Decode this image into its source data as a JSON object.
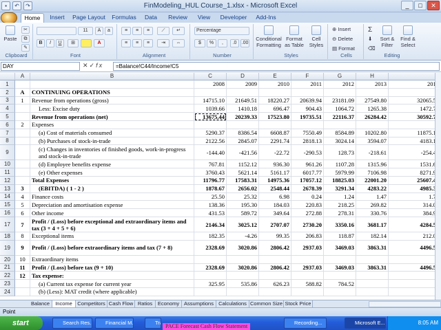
{
  "window": {
    "title": "FinModeling_HUL Course_1.xlsx - Microsoft Excel"
  },
  "ribbon_tabs": [
    "Home",
    "Insert",
    "Page Layout",
    "Formulas",
    "Data",
    "Review",
    "View",
    "Developer",
    "Add-Ins"
  ],
  "ribbon": {
    "clipboard": {
      "label": "Clipboard",
      "paste": "Paste"
    },
    "font": {
      "label": "Font",
      "name": "",
      "size": "11",
      "bold": "B",
      "italic": "I",
      "underline": "U"
    },
    "alignment": {
      "label": "Alignment"
    },
    "number": {
      "label": "Number",
      "format": "Percentage",
      "currency": "$",
      "percent": "%",
      "comma": ","
    },
    "styles": {
      "label": "Styles",
      "conditional": "Conditional Formatting",
      "format_table": "Format as Table",
      "cell_styles": "Cell Styles"
    },
    "cells": {
      "label": "Cells",
      "insert": "Insert",
      "delete": "Delete",
      "format": "Format"
    },
    "editing": {
      "label": "Editing",
      "sum": "Σ",
      "sort": "Sort & Filter",
      "find": "Find & Select"
    }
  },
  "formula_bar": {
    "name_box": "DAY",
    "fx": "fx",
    "formula": "=Balance!C44/Income!C5"
  },
  "columns": [
    "A",
    "B",
    "C",
    "D",
    "E",
    "F",
    "G",
    "H",
    "I"
  ],
  "rows": [
    {
      "n": "1",
      "a": "",
      "b": "",
      "v": [
        "2008",
        "2009",
        "2010",
        "2011",
        "2012",
        "2013",
        "2014"
      ],
      "bold": false
    },
    {
      "n": "2",
      "a": "A",
      "b": "CONTINUING OPERATIONS",
      "v": [
        "",
        "",
        "",
        "",
        "",
        "",
        ""
      ],
      "bold": true
    },
    {
      "n": "3",
      "a": "1",
      "b": "Revenue from operations (gross)",
      "v": [
        "14715.10",
        "21649.51",
        "18220.27",
        "20639.94",
        "23181.09",
        "27549.80",
        "32065.57"
      ],
      "bold": false
    },
    {
      "n": "4",
      "a": "",
      "b": "Less: Excise duty",
      "v": [
        "1039.66",
        "1410.18",
        "696.47",
        "904.43",
        "1064.72",
        "1265.38",
        "1472.79"
      ],
      "bold": false
    },
    {
      "n": "5",
      "a": "",
      "b": "Revenue from operations (net)",
      "v": [
        "13675.44",
        "20239.33",
        "17523.80",
        "19735.51",
        "22116.37",
        "26284.42",
        "30592.78"
      ],
      "bold": true
    },
    {
      "n": "6",
      "a": "2",
      "b": "Expenses",
      "v": [
        "",
        "",
        "",
        "",
        "",
        "",
        ""
      ],
      "bold": false
    },
    {
      "n": "7",
      "a": "",
      "b": "(a) Cost of materials consumed",
      "v": [
        "5290.37",
        "8386.54",
        "6608.87",
        "7550.49",
        "8584.89",
        "10202.80",
        "11875.17"
      ],
      "bold": false
    },
    {
      "n": "8",
      "a": "",
      "b": "(b) Purchases of stock-in-trade",
      "v": [
        "2122.56",
        "2845.07",
        "2291.74",
        "2818.13",
        "3024.14",
        "3594.07",
        "4183.18"
      ],
      "bold": false
    },
    {
      "n": "9",
      "a": "",
      "b": "(c) Changes in inventories of finished goods, work-in-progress and stock-in-trade",
      "v": [
        "-144.40",
        "-421.56",
        "-22.72",
        "-290.53",
        "128.73",
        "-218.61",
        "-254.44"
      ],
      "bold": false
    },
    {
      "n": "10",
      "a": "",
      "b": "(d) Employee benefits expense",
      "v": [
        "767.81",
        "1152.12",
        "936.30",
        "961.26",
        "1107.28",
        "1315.96",
        "1531.66"
      ],
      "bold": false
    },
    {
      "n": "11",
      "a": "",
      "b": "(e) Other expenses",
      "v": [
        "3760.43",
        "5621.14",
        "5161.17",
        "6017.77",
        "5979.99",
        "7106.98",
        "8271.91"
      ],
      "bold": false
    },
    {
      "n": "12",
      "a": "",
      "b": "Total Expenses",
      "v": [
        "11796.77",
        "17583.31",
        "14975.36",
        "17057.12",
        "18825.03",
        "22001.20",
        "25607.48"
      ],
      "bold": true
    },
    {
      "n": "13",
      "a": "3",
      "b": "(EBITDA) ( 1 - 2 )",
      "v": [
        "1878.67",
        "2656.02",
        "2548.44",
        "2678.39",
        "3291.34",
        "4283.22",
        "4985.30"
      ],
      "bold": true
    },
    {
      "n": "14",
      "a": "4",
      "b": "Finance costs",
      "v": [
        "25.50",
        "25.32",
        "6.98",
        "0.24",
        "1.24",
        "1.47",
        "1.72"
      ],
      "bold": false
    },
    {
      "n": "15",
      "a": "5",
      "b": "Depreciation and amortisation expense",
      "v": [
        "138.36",
        "195.30",
        "184.03",
        "220.83",
        "218.25",
        "269.82",
        "314.04"
      ],
      "bold": false
    },
    {
      "n": "16",
      "a": "6",
      "b": "Other income",
      "v": [
        "431.53",
        "589.72",
        "349.64",
        "272.88",
        "278.31",
        "330.76",
        "384.98"
      ],
      "bold": false
    },
    {
      "n": "17",
      "a": "7",
      "b": "Profit / (Loss) before exceptional and extraordinary items and tax (3 + 4 + 5 + 6)",
      "v": [
        "2146.34",
        "3025.12",
        "2707.07",
        "2730.20",
        "3350.16",
        "3681.17",
        "4284.57"
      ],
      "bold": true
    },
    {
      "n": "18",
      "a": "8",
      "b": "Exceptional items",
      "v": [
        "182.35",
        "-4.26",
        "99.35",
        "206.83",
        "118.87",
        "182.14",
        "212.00"
      ],
      "bold": false
    },
    {
      "n": "19",
      "a": "9",
      "b": "Profit / (Loss) before extraordinary items and tax (7 + 8)",
      "v": [
        "2328.69",
        "3020.86",
        "2806.42",
        "2937.03",
        "3469.03",
        "3863.31",
        "4496.56"
      ],
      "bold": true
    },
    {
      "n": "20",
      "a": "10",
      "b": "Extraordinary items",
      "v": [
        "",
        "",
        "",
        "",
        "",
        "",
        ""
      ],
      "bold": false
    },
    {
      "n": "21",
      "a": "11",
      "b": "Profit / (Loss) before tax (9 + 10)",
      "v": [
        "2328.69",
        "3020.86",
        "2806.42",
        "2937.03",
        "3469.03",
        "3863.31",
        "4496.56"
      ],
      "bold": true
    },
    {
      "n": "22",
      "a": "12",
      "b": "Tax expense:",
      "v": [
        "",
        "",
        "",
        "",
        "",
        "",
        ""
      ],
      "bold": true
    },
    {
      "n": "23",
      "a": "",
      "b": "(a) Current tax expense for current year",
      "v": [
        "325.95",
        "535.86",
        "626.23",
        "588.82",
        "784.52",
        "",
        ""
      ],
      "bold": false
    },
    {
      "n": "24",
      "a": "",
      "b": "(b) (Less): MAT credit (where applicable)",
      "v": [
        "",
        "",
        "",
        "",
        "",
        "",
        ""
      ],
      "bold": false
    }
  ],
  "sheet_tabs": [
    "Balance",
    "Income",
    "Competitors",
    "Cash Flow",
    "Ratios",
    "Economy",
    "Assumptions",
    "Calculations",
    "Common Size",
    "Stock Price"
  ],
  "status": {
    "mode": "Point"
  },
  "taskbar": {
    "start": "start",
    "items": [
      "Search Res...",
      "Financial M...",
      "Trai",
      "Recording...",
      "Microsoft E..."
    ],
    "clock": "8:05 AM",
    "overlay": "PACE   Forecast Cash Flow Statement"
  }
}
